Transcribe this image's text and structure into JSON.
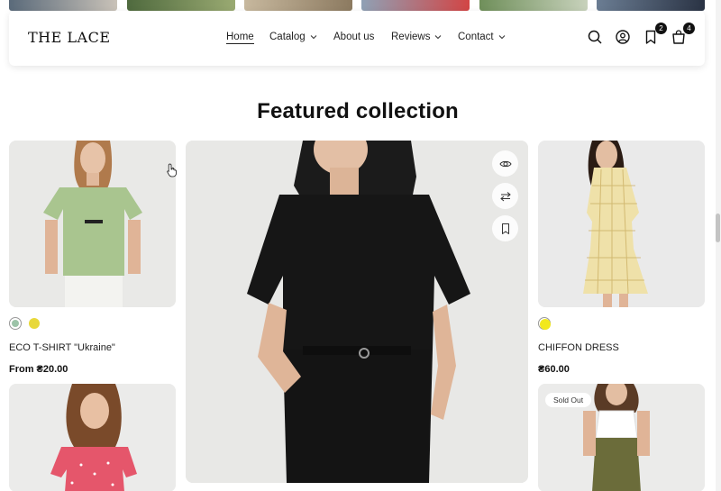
{
  "header": {
    "logo": "THE LACE",
    "nav": [
      {
        "label": "Home",
        "active": true,
        "dropdown": false
      },
      {
        "label": "Catalog",
        "active": false,
        "dropdown": true
      },
      {
        "label": "About us",
        "active": false,
        "dropdown": false
      },
      {
        "label": "Reviews",
        "active": false,
        "dropdown": true
      },
      {
        "label": "Contact",
        "active": false,
        "dropdown": true
      }
    ],
    "icons": [
      "search-icon",
      "account-icon",
      "wishlist-icon",
      "cart-icon"
    ],
    "wishlist_count": "2",
    "cart_count": "4"
  },
  "section": {
    "title": "Featured collection"
  },
  "products": [
    {
      "name": "ECO T-SHIRT \"Ukraine\"",
      "price": "From ₴20.00",
      "swatches": [
        "#9cc3a8",
        "#e8d83a"
      ]
    },
    {
      "name": "CHIFFON DRESS",
      "price": "₴60.00",
      "swatches": [
        "#f2e81c"
      ]
    }
  ],
  "featured_actions": [
    "quick-view-icon",
    "compare-icon",
    "bookmark-icon"
  ],
  "sold_out_label": "Sold Out",
  "colors": {
    "text": "#111111",
    "badge": "#111111",
    "card_bg": "#eeeeee"
  }
}
